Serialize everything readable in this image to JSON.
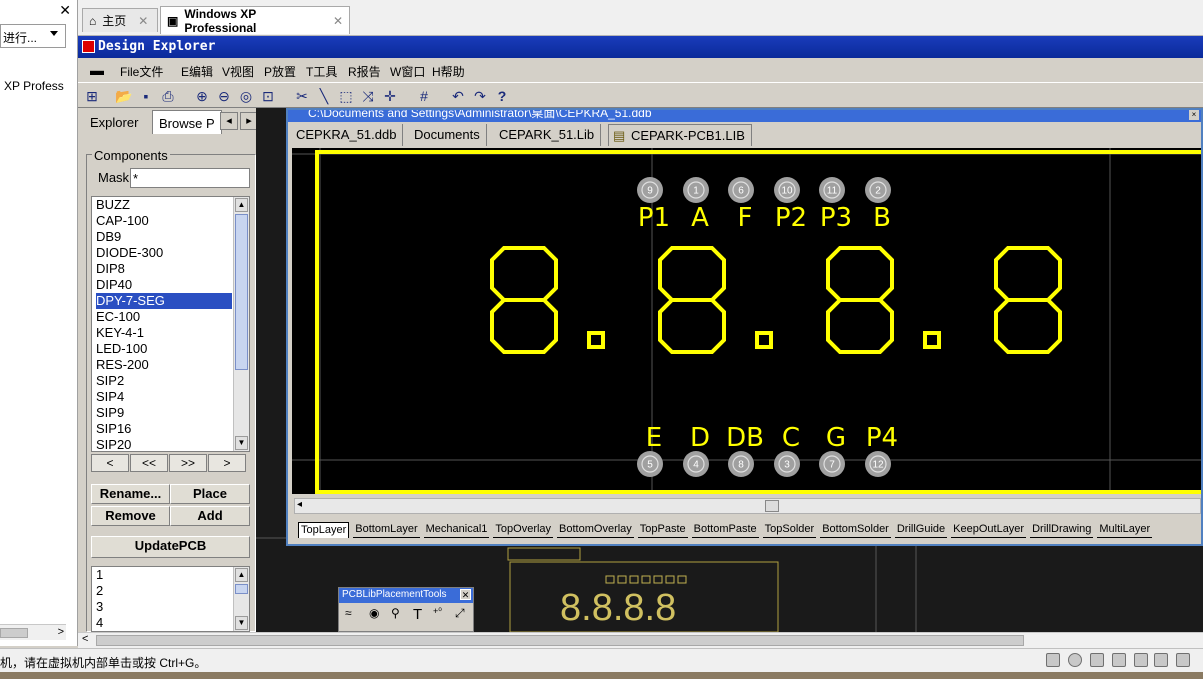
{
  "host": {
    "close_glyph": "✕",
    "combo_value": "进行...",
    "vm_item": "XP Profess",
    "tabs": [
      {
        "label": "主页",
        "icon": "home-icon"
      },
      {
        "label": "Windows XP Professional",
        "icon": "vm-icon"
      }
    ],
    "tab_close": "✕",
    "status_text": "机，请在虚拟机内部单击或按 Ctrl+G。"
  },
  "app": {
    "title": "Design Explorer",
    "menu": [
      "File文件",
      "E编辑",
      "V视图",
      "P放置",
      "T工具",
      "R报告",
      "W窗口",
      "H帮助"
    ]
  },
  "panel": {
    "tabs": [
      "Explorer",
      "Browse P"
    ],
    "group_label": "Components",
    "mask_label": "Mask",
    "mask_value": "*",
    "components": [
      "BUZZ",
      "CAP-100",
      "DB9",
      "DIODE-300",
      "DIP8",
      "DIP40",
      "DPY-7-SEG",
      "EC-100",
      "KEY-4-1",
      "LED-100",
      "RES-200",
      "SIP2",
      "SIP4",
      "SIP9",
      "SIP16",
      "SIP20"
    ],
    "selected": "DPY-7-SEG",
    "nav": [
      "<",
      "<<",
      ">>",
      ">"
    ],
    "buttons": {
      "rename": "Rename...",
      "place": "Place",
      "remove": "Remove",
      "add": "Add",
      "update": "UpdatePCB"
    },
    "pads": [
      "1",
      "2",
      "3",
      "4"
    ]
  },
  "document": {
    "caption": "C:\\Documents and Settings\\Administrator\\桌面\\CEPKRA_51.ddb",
    "tabs": [
      "CEPKRA_51.ddb",
      "Documents",
      "CEPARK_51.Lib",
      "CEPARK-PCB1.LIB"
    ],
    "active_tab": "CEPARK-PCB1.LIB",
    "top_pins": [
      {
        "num": "9",
        "label": "P1"
      },
      {
        "num": "1",
        "label": "A"
      },
      {
        "num": "6",
        "label": "F"
      },
      {
        "num": "10",
        "label": "P2"
      },
      {
        "num": "11",
        "label": "P3"
      },
      {
        "num": "2",
        "label": "B"
      }
    ],
    "bottom_pins": [
      {
        "num": "5",
        "label": "E"
      },
      {
        "num": "4",
        "label": "D"
      },
      {
        "num": "8",
        "label": "DB"
      },
      {
        "num": "3",
        "label": "C"
      },
      {
        "num": "7",
        "label": "G"
      },
      {
        "num": "12",
        "label": "P4"
      }
    ],
    "digits": "8.8.8.8",
    "layers": [
      "TopLayer",
      "BottomLayer",
      "Mechanical1",
      "TopOverlay",
      "BottomOverlay",
      "TopPaste",
      "BottomPaste",
      "TopSolder",
      "BottomSolder",
      "DrillGuide",
      "KeepOutLayer",
      "DrillDrawing",
      "MultiLayer"
    ]
  },
  "tools": {
    "title": "PCBLibPlacementTools",
    "close": "✕",
    "text_tool": "T"
  },
  "colors": {
    "outline": "#ffff00",
    "pad": "#a0a0a0",
    "title_bar": "#0a2a9a",
    "selection": "#2a4fc2"
  }
}
